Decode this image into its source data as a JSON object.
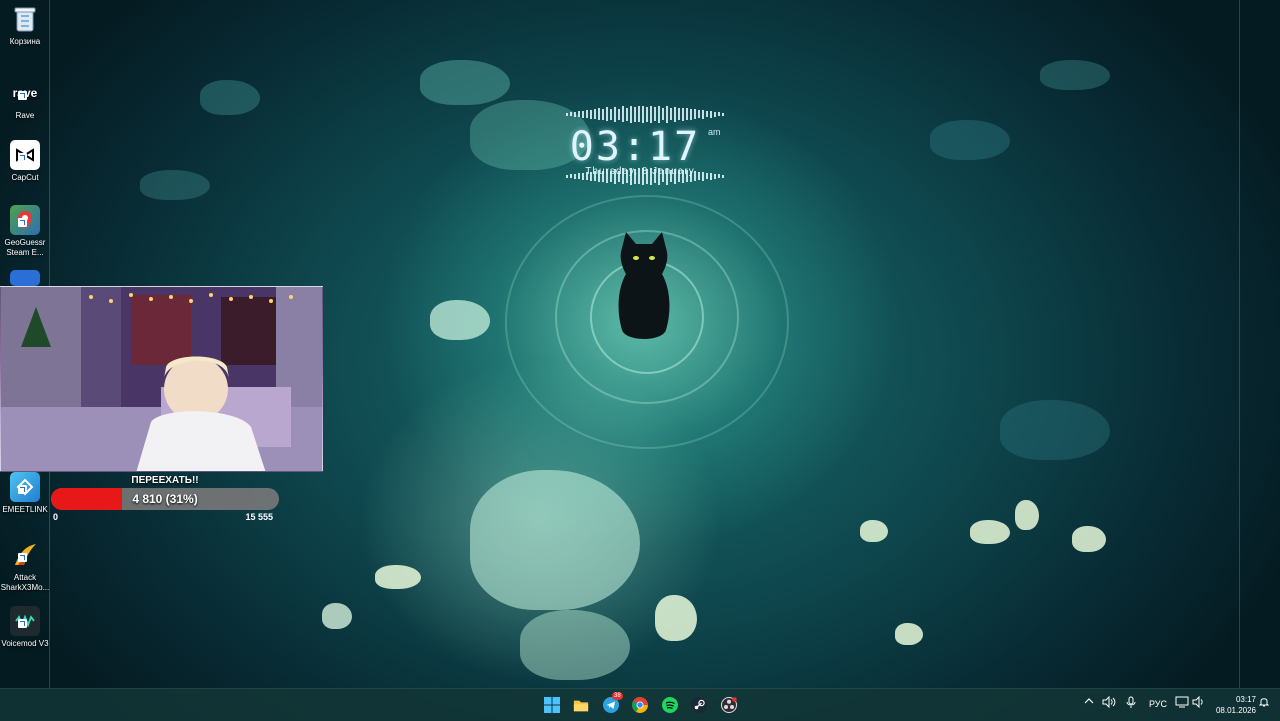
{
  "desktop": {
    "icons": [
      {
        "label": "Корзина",
        "icon": "recycle-bin-icon"
      },
      {
        "label": "Rave",
        "icon": "rave-icon",
        "glyph": "rave"
      },
      {
        "label": "CapCut",
        "icon": "capcut-icon"
      },
      {
        "label": "GeoGuessr Steam E...",
        "icon": "geoguessr-icon"
      },
      {
        "label": "EMEETLINK",
        "icon": "emeetlink-icon"
      },
      {
        "label": "Attack SharkX3Mo...",
        "icon": "attack-shark-icon"
      },
      {
        "label": "Voicemod V3",
        "icon": "voicemod-icon"
      }
    ]
  },
  "clock_widget": {
    "time": "03:17",
    "ampm": "am",
    "date": "Thursday, 8 January"
  },
  "donation_goal": {
    "title": "ПЕРЕЕХАТЬ!!",
    "current_text": "4 810 (31%)",
    "progress": 0.31,
    "min": "0",
    "max": "15 555",
    "colors": {
      "fill": "#e81818",
      "track": "#787878"
    }
  },
  "taskbar": {
    "apps": [
      {
        "name": "start",
        "icon": "windows-start-icon"
      },
      {
        "name": "explorer",
        "icon": "folder-icon"
      },
      {
        "name": "telegram",
        "icon": "telegram-icon",
        "badge": "38"
      },
      {
        "name": "chrome",
        "icon": "chrome-icon"
      },
      {
        "name": "spotify",
        "icon": "spotify-icon"
      },
      {
        "name": "steam",
        "icon": "steam-icon"
      },
      {
        "name": "obs",
        "icon": "obs-icon"
      }
    ],
    "tray": {
      "language": "РУС",
      "time": "03:17",
      "date": "08.01.2026"
    }
  }
}
